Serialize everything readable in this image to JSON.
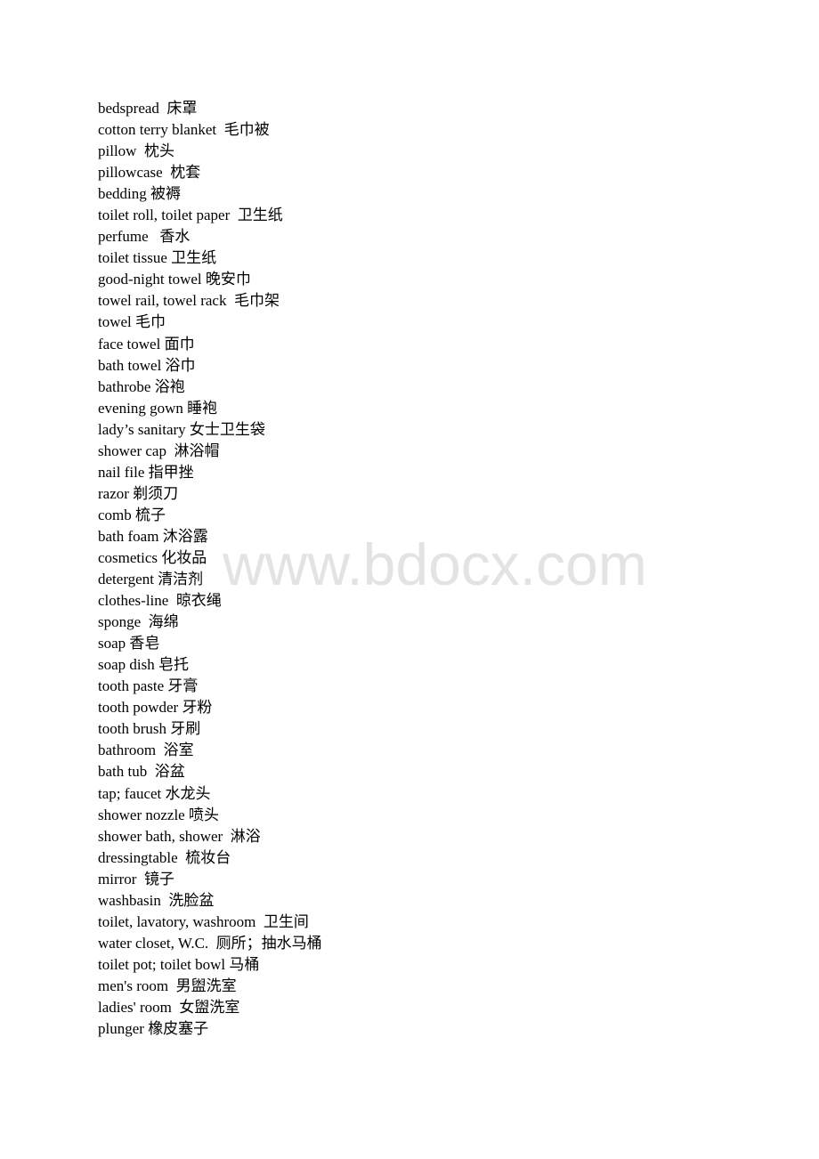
{
  "document": {
    "entries": [
      {
        "en": "bedspread",
        "sep": "  ",
        "zh": "床罩"
      },
      {
        "en": "cotton terry blanket",
        "sep": "  ",
        "zh": "毛巾被"
      },
      {
        "en": "pillow",
        "sep": "  ",
        "zh": "枕头"
      },
      {
        "en": "pillowcase",
        "sep": "  ",
        "zh": "枕套"
      },
      {
        "en": "bedding",
        "sep": " ",
        "zh": "被褥"
      },
      {
        "en": "toilet roll, toilet paper",
        "sep": "  ",
        "zh": "卫生纸"
      },
      {
        "en": "perfume",
        "sep": "   ",
        "zh": "香水"
      },
      {
        "en": "toilet tissue",
        "sep": " ",
        "zh": "卫生纸"
      },
      {
        "en": "good-night towel",
        "sep": " ",
        "zh": "晚安巾"
      },
      {
        "en": "towel rail, towel rack",
        "sep": "  ",
        "zh": "毛巾架"
      },
      {
        "en": "towel",
        "sep": " ",
        "zh": "毛巾"
      },
      {
        "en": "face towel",
        "sep": " ",
        "zh": "面巾"
      },
      {
        "en": "bath towel",
        "sep": " ",
        "zh": "浴巾"
      },
      {
        "en": "bathrobe",
        "sep": " ",
        "zh": "浴袍"
      },
      {
        "en": "evening gown",
        "sep": " ",
        "zh": "睡袍"
      },
      {
        "en": "lady’s sanitary",
        "sep": " ",
        "zh": "女士卫生袋"
      },
      {
        "en": "shower cap",
        "sep": "  ",
        "zh": "淋浴帽"
      },
      {
        "en": "nail file",
        "sep": " ",
        "zh": "指甲挫"
      },
      {
        "en": "razor",
        "sep": " ",
        "zh": "剃须刀"
      },
      {
        "en": "comb",
        "sep": " ",
        "zh": "梳子"
      },
      {
        "en": "bath foam",
        "sep": " ",
        "zh": "沐浴露"
      },
      {
        "en": "cosmetics",
        "sep": " ",
        "zh": "化妆品"
      },
      {
        "en": "detergent",
        "sep": " ",
        "zh": "清洁剂"
      },
      {
        "en": "clothes-line",
        "sep": "  ",
        "zh": "晾衣绳"
      },
      {
        "en": "sponge",
        "sep": "  ",
        "zh": "海绵"
      },
      {
        "en": "soap",
        "sep": " ",
        "zh": "香皂"
      },
      {
        "en": "soap dish",
        "sep": " ",
        "zh": "皂托"
      },
      {
        "en": "tooth paste",
        "sep": " ",
        "zh": "牙膏"
      },
      {
        "en": "tooth powder",
        "sep": " ",
        "zh": "牙粉"
      },
      {
        "en": "tooth brush",
        "sep": " ",
        "zh": "牙刷"
      },
      {
        "en": "bathroom",
        "sep": "  ",
        "zh": "浴室"
      },
      {
        "en": "bath tub",
        "sep": "  ",
        "zh": "浴盆"
      },
      {
        "en": "tap; faucet",
        "sep": " ",
        "zh": "水龙头"
      },
      {
        "en": "shower nozzle",
        "sep": " ",
        "zh": "喷头"
      },
      {
        "en": "shower bath, shower",
        "sep": "  ",
        "zh": "淋浴"
      },
      {
        "en": "dressingtable",
        "sep": "  ",
        "zh": "梳妆台"
      },
      {
        "en": "mirror",
        "sep": "  ",
        "zh": "镜子"
      },
      {
        "en": "washbasin",
        "sep": "  ",
        "zh": "洗脸盆"
      },
      {
        "en": "toilet, lavatory, washroom",
        "sep": "  ",
        "zh": "卫生间"
      },
      {
        "en": "water closet, W.C.",
        "sep": "  ",
        "zh": "厕所；抽水马桶"
      },
      {
        "en": "toilet pot; toilet bowl",
        "sep": " ",
        "zh": "马桶"
      },
      {
        "en": "men's room",
        "sep": "  ",
        "zh": "男盥洗室"
      },
      {
        "en": "ladies' room",
        "sep": "  ",
        "zh": "女盥洗室"
      },
      {
        "en": "plunger",
        "sep": " ",
        "zh": "橡皮塞子"
      }
    ]
  },
  "watermark": {
    "text": "www.bdocx.com",
    "color": "#e3e3e3"
  }
}
